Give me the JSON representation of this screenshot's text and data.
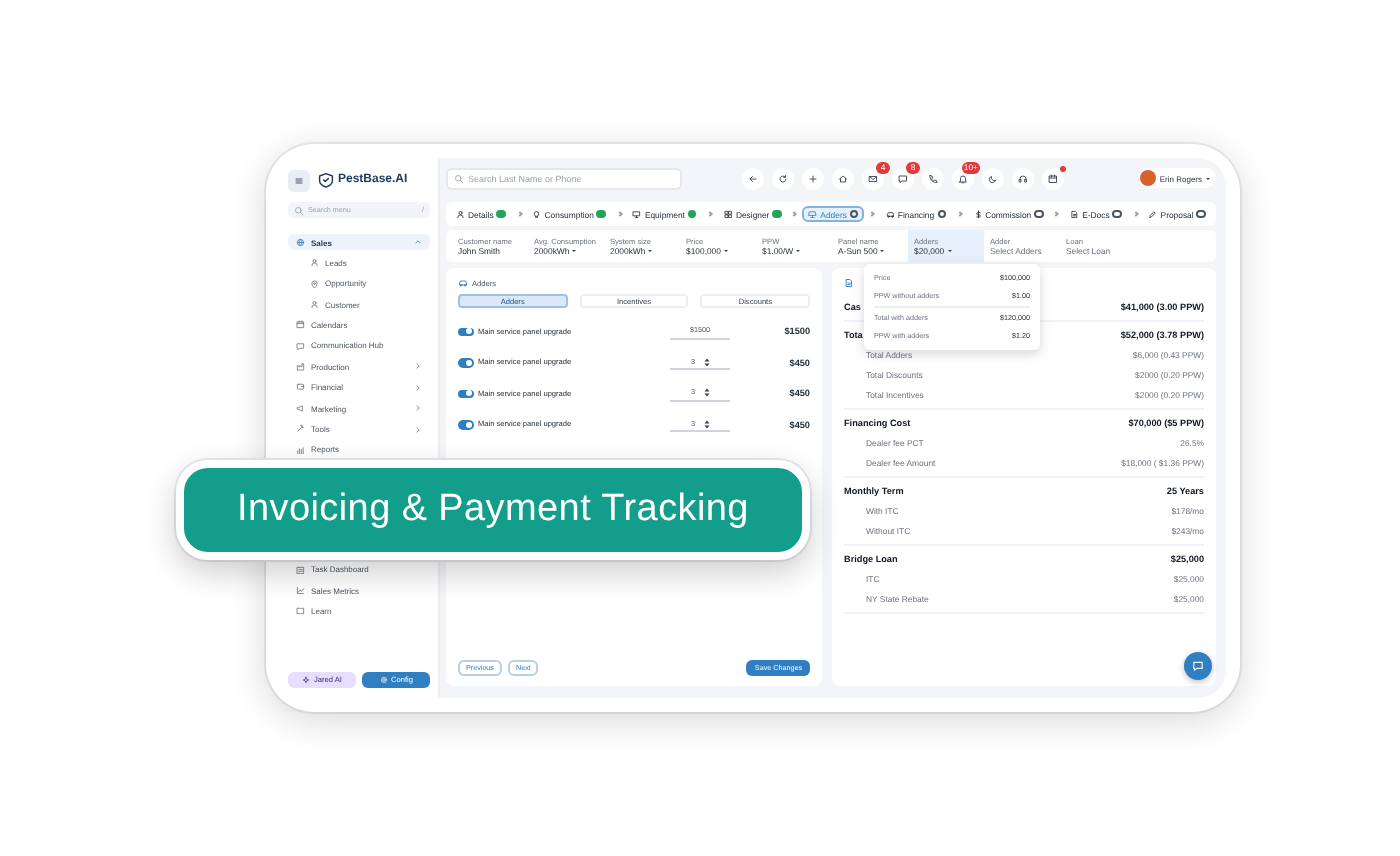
{
  "app": {
    "logo": "PestBase.AI"
  },
  "search": {
    "placeholder": "Search Last Name or Phone"
  },
  "toolbar": [
    {
      "kind": "plain"
    },
    {
      "kind": "plain"
    },
    {
      "kind": "plain"
    },
    {
      "kind": "plain"
    },
    {
      "kind": "count",
      "badge": "4"
    },
    {
      "kind": "count",
      "badge": "8"
    },
    {
      "kind": "plain"
    },
    {
      "kind": "count",
      "badge": "10+"
    },
    {
      "kind": "plain"
    },
    {
      "kind": "plain"
    },
    {
      "kind": "dot"
    }
  ],
  "user": {
    "name": "Erin Rogers"
  },
  "sidebar": {
    "search_placeholder": "Search menu",
    "shortcut": "/",
    "items": [
      {
        "label": "Sales",
        "selected": true,
        "expanded": true,
        "children": [
          {
            "label": "Leads",
            "selected": false
          },
          {
            "label": "Opportunity",
            "selected": false
          },
          {
            "label": "Customer",
            "selected": false
          }
        ]
      },
      {
        "label": "Calendars",
        "selected": false
      },
      {
        "label": "Communication Hub",
        "selected": false
      },
      {
        "label": "Production",
        "selected": false,
        "expanded": false
      },
      {
        "label": "Financial",
        "selected": false,
        "expanded": false
      },
      {
        "label": "Marketing",
        "selected": false,
        "expanded": false
      },
      {
        "label": "Tools",
        "selected": false,
        "expanded": false
      },
      {
        "label": "Reports",
        "selected": false
      }
    ],
    "lower_items": [
      {
        "label": "Task Dashboard",
        "selected": false
      },
      {
        "label": "Sales Metrics",
        "selected": false
      },
      {
        "label": "Learn",
        "selected": false
      }
    ],
    "buttons": [
      {
        "label": "Jared AI",
        "kind": "ai"
      },
      {
        "label": "Config",
        "kind": "primary"
      }
    ]
  },
  "steps": [
    {
      "label": "Details",
      "done": true,
      "selected": false
    },
    {
      "label": "Consumption",
      "done": true,
      "selected": false
    },
    {
      "label": "Equipment",
      "done": true,
      "selected": false
    },
    {
      "label": "Designer",
      "done": true,
      "selected": false
    },
    {
      "label": "Adders",
      "done": false,
      "selected": true
    },
    {
      "label": "Financing",
      "done": false,
      "selected": false
    },
    {
      "label": "Commission",
      "done": false,
      "selected": false
    },
    {
      "label": "E-Docs",
      "done": false,
      "selected": false
    },
    {
      "label": "Proposal",
      "done": false,
      "selected": false
    }
  ],
  "summary": [
    {
      "label": "Customer name",
      "value": "John Smith",
      "dropdown": false,
      "selected": false
    },
    {
      "label": "Avg. Consumption",
      "value": "2000kWh",
      "dropdown": true,
      "selected": false
    },
    {
      "label": "System size",
      "value": "2000kWh",
      "dropdown": true,
      "selected": false
    },
    {
      "label": "Price",
      "value": "$100,000",
      "dropdown": true,
      "selected": false
    },
    {
      "label": "PPW",
      "value": "$1.00/W",
      "dropdown": true,
      "selected": false
    },
    {
      "label": "Panel name",
      "value": "A-Sun 500",
      "dropdown": true,
      "selected": false
    },
    {
      "label": "Adders",
      "value": "$20,000",
      "dropdown": true,
      "selected": true
    },
    {
      "label": "Adder",
      "value": "Select Adders",
      "dropdown": false,
      "selected": false
    },
    {
      "label": "Loan",
      "value": "Select Loan",
      "dropdown": false,
      "selected": false
    }
  ],
  "adders": {
    "title": "Adders",
    "tabs": [
      {
        "label": "Adders",
        "selected": true
      },
      {
        "label": "Incentives",
        "selected": false
      },
      {
        "label": "Discounts",
        "selected": false
      }
    ],
    "rows": [
      {
        "label": "Main service panel upgrade",
        "on": true,
        "kind": "text",
        "input": "$1500",
        "amount": "$1500"
      },
      {
        "label": "Main service panel upgrade",
        "on": true,
        "kind": "stepper",
        "input": "3",
        "amount": "$450"
      },
      {
        "label": "Main service panel upgrade",
        "on": true,
        "kind": "stepper",
        "input": "3",
        "amount": "$450"
      },
      {
        "label": "Main service panel upgrade",
        "on": true,
        "kind": "stepper",
        "input": "3",
        "amount": "$450"
      }
    ],
    "buttons": [
      {
        "label": "Previous",
        "kind": "outline"
      },
      {
        "label": "Next",
        "kind": "outline"
      },
      {
        "label": "Save Changes",
        "kind": "primary"
      }
    ]
  },
  "popup": {
    "groups": [
      [
        {
          "label": "Price",
          "value": "$100,000"
        },
        {
          "label": "PPW without adders",
          "value": "$1.00"
        }
      ],
      [
        {
          "label": "Total with adders",
          "value": "$120,000"
        },
        {
          "label": "PPW with adders",
          "value": "$1.20"
        }
      ]
    ]
  },
  "pricing": {
    "sections": [
      {
        "rows": [
          {
            "label": "Cas",
            "value": "$41,000 (3.00 PPW)",
            "kind": "head"
          }
        ]
      },
      {
        "rows": [
          {
            "label": "Tota",
            "value": "$52,000 (3.78 PPW)",
            "kind": "head"
          },
          {
            "label": "Total Adders",
            "value": "$6,000 (0.43 PPW)",
            "kind": "sub"
          },
          {
            "label": "Total Discounts",
            "value": "$2000 (0.20 PPW)",
            "kind": "sub"
          },
          {
            "label": "Total Incentives",
            "value": "$2000 (0.20 PPW)",
            "kind": "sub"
          }
        ]
      },
      {
        "rows": [
          {
            "label": "Financing Cost",
            "value": "$70,000 ($5 PPW)",
            "kind": "head"
          },
          {
            "label": "Dealer fee PCT",
            "value": "26.5%",
            "kind": "sub"
          },
          {
            "label": "Dealer fee Amount",
            "value": "$18,000 ( $1.36 PPW)",
            "kind": "sub"
          }
        ]
      },
      {
        "rows": [
          {
            "label": "Monthly Term",
            "value": "25 Years",
            "kind": "head"
          },
          {
            "label": "With ITC",
            "value": "$178/mo",
            "kind": "sub"
          },
          {
            "label": "Without ITC",
            "value": "$243/mo",
            "kind": "sub"
          }
        ]
      },
      {
        "rows": [
          {
            "label": "Bridge Loan",
            "value": "$25,000",
            "kind": "head"
          },
          {
            "label": "ITC",
            "value": "$25,000",
            "kind": "sub"
          },
          {
            "label": "NY State Rebate",
            "value": "$25,000",
            "kind": "sub"
          }
        ]
      }
    ]
  },
  "banner": {
    "text": "Invoicing & Payment Tracking"
  }
}
